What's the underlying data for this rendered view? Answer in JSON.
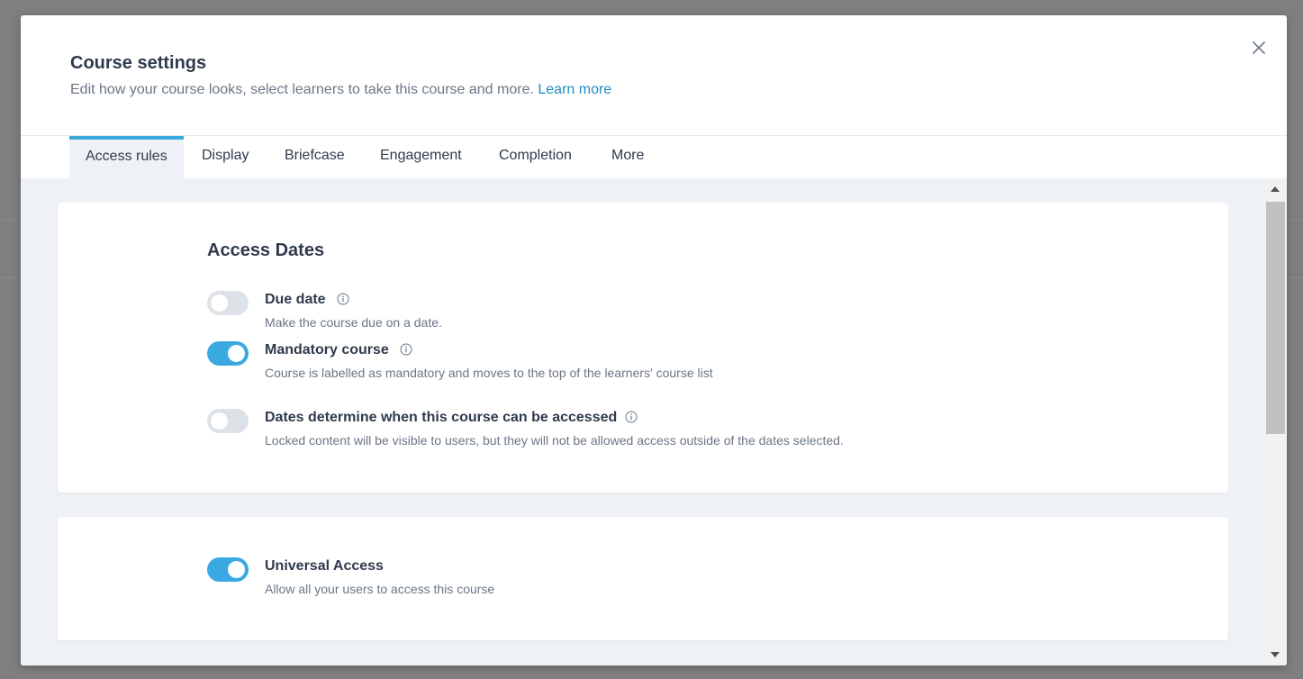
{
  "modal": {
    "title": "Course settings",
    "subtitle": "Edit how your course looks, select learners to take this course and more.",
    "learn_more": "Learn more"
  },
  "tabs": [
    {
      "label": "Access rules",
      "active": true
    },
    {
      "label": "Display",
      "active": false
    },
    {
      "label": "Briefcase",
      "active": false
    },
    {
      "label": "Engagement",
      "active": false
    },
    {
      "label": "Completion",
      "active": false
    },
    {
      "label": "More",
      "active": false
    }
  ],
  "access_dates": {
    "title": "Access Dates",
    "settings": [
      {
        "label": "Due date",
        "description": "Make the course due on a date.",
        "enabled": false,
        "info_icon": "info-icon"
      },
      {
        "label": "Mandatory course",
        "description": "Course is labelled as mandatory and moves to the top of the learners' course list",
        "enabled": true,
        "info_icon": "info-icon"
      },
      {
        "label": "Dates determine when this course can be accessed",
        "description": "Locked content will be visible to users, but they will not be allowed access outside of the dates selected.",
        "enabled": false,
        "info_icon": "info-icon"
      }
    ]
  },
  "universal_access": {
    "label": "Universal Access",
    "description": "Allow all your users to access this course",
    "enabled": true
  },
  "colors": {
    "accent": "#3aa9e2",
    "link": "#1f8ac0",
    "toggle_off": "#dde2e8",
    "content_bg": "#eef1f5"
  }
}
